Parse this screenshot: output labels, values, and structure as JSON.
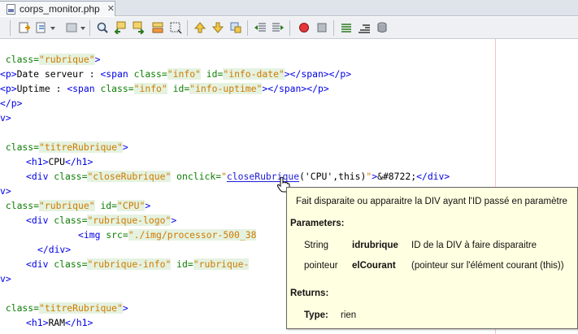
{
  "tab": {
    "label": "corps_monitor.php",
    "close": "✕"
  },
  "toolbar": {
    "icons": [
      "back-icon",
      "forward-icon",
      "last-edit-icon",
      "find-icon",
      "find-prev-icon",
      "find-next-icon",
      "toggle-highlight-icon",
      "toggle-rect-select-icon",
      "prev-bookmark-icon",
      "next-bookmark-icon",
      "toggle-bookmark-icon",
      "shift-left-icon",
      "shift-right-icon",
      "record-macro-icon",
      "stop-macro-icon",
      "diff-icon",
      "comment-icon",
      "database-icon"
    ]
  },
  "code": {
    "line1": [
      " class=",
      "\"rubrique\"",
      ">"
    ],
    "line2": [
      "<p>",
      "Date serveur : ",
      "<span ",
      "class=",
      "\"info\"",
      " id=",
      "\"info-date\"",
      ">",
      "</span>",
      "</p>"
    ],
    "line3": [
      "<p>",
      "Uptime : ",
      "<span ",
      "class=",
      "\"info\"",
      " id=",
      "\"info-uptime\"",
      ">",
      "</span>",
      "</p>"
    ],
    "line4": "</p>",
    "line5": "v>",
    "line7": [
      " class=",
      "\"titreRubrique\"",
      ">"
    ],
    "line8": [
      "<h1>",
      "CPU",
      "</h1>"
    ],
    "line9": [
      "<div ",
      "class=",
      "\"closeRubrique\"",
      " onclick=",
      "\"",
      "closeRubrique",
      "('CPU',this)",
      "\"",
      ">",
      "&#8722;",
      "</div>"
    ],
    "line10": "v>",
    "line11": [
      " class=",
      "\"rubrique\"",
      " id=",
      "\"CPU\"",
      ">"
    ],
    "line12": [
      "<div ",
      "class=",
      "\"rubrique-logo\"",
      ">"
    ],
    "line13": [
      "<img ",
      "src=",
      "\"./img/processor-500_38"
    ],
    "line14": "</div>",
    "line15": [
      "<div ",
      "class=",
      "\"rubrique-info\"",
      " id=",
      "\"rubrique-"
    ],
    "line16": "v>",
    "line18": [
      " class=",
      "\"titreRubrique\"",
      ">"
    ],
    "line19": [
      "<h1>",
      "RAM",
      "</h1>"
    ]
  },
  "tooltip": {
    "description": "Fait disparaite ou apparaitre la DIV ayant l'ID passé en paramètre",
    "parameters_heading": "Parameters:",
    "params": [
      {
        "type": "String",
        "name": "idrubrique",
        "desc": "ID de la DIV à faire disparaitre"
      },
      {
        "type": "pointeur",
        "name": "elCourant",
        "desc": "(pointeur sur l'élément courant (this))"
      }
    ],
    "returns_heading": "Returns:",
    "returns_type_label": "Type:",
    "returns_type_value": "rien"
  }
}
